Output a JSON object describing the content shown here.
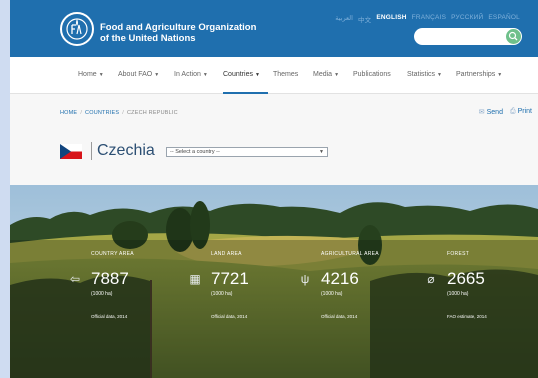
{
  "header": {
    "org_line1": "Food and Agriculture Organization",
    "org_line2": "of the United Nations",
    "languages": [
      "العربية",
      "中文",
      "ENGLISH",
      "FRANÇAIS",
      "РУССКИЙ",
      "ESPAÑOL"
    ],
    "active_language": "ENGLISH",
    "search_placeholder": ""
  },
  "nav": {
    "items": [
      {
        "label": "Home",
        "dropdown": true
      },
      {
        "label": "About FAO",
        "dropdown": true
      },
      {
        "label": "In Action",
        "dropdown": true
      },
      {
        "label": "Countries",
        "dropdown": true,
        "active": true
      },
      {
        "label": "Themes",
        "dropdown": false
      },
      {
        "label": "Media",
        "dropdown": true
      },
      {
        "label": "Publications",
        "dropdown": false
      },
      {
        "label": "Statistics",
        "dropdown": true
      },
      {
        "label": "Partnerships",
        "dropdown": true
      }
    ]
  },
  "breadcrumb": {
    "home": "HOME",
    "countries": "COUNTRIES",
    "current": "CZECH REPUBLIC"
  },
  "tools": {
    "send": "Send",
    "print": "Print"
  },
  "country": {
    "name": "Czechia",
    "select_value": "-- Select a country --"
  },
  "stats": [
    {
      "label": "COUNTRY AREA",
      "value": "7887",
      "unit": "(1000 ha)",
      "source": "Official data, 2014",
      "icon": "map-arrow-icon"
    },
    {
      "label": "LAND AREA",
      "value": "7721",
      "unit": "(1000 ha)",
      "source": "Official data, 2014",
      "icon": "grid-icon"
    },
    {
      "label": "AGRICULTURAL AREA",
      "value": "4216",
      "unit": "(1000 ha)",
      "source": "Official data, 2014",
      "icon": "wheat-icon"
    },
    {
      "label": "FOREST",
      "value": "2665",
      "unit": "(1000 ha)",
      "source": "FAO estimate, 2014",
      "icon": "leaf-icon"
    }
  ],
  "colors": {
    "header_blue": "#1f6fae",
    "search_green": "#6fc08b",
    "title_blue": "#2c4f73"
  }
}
